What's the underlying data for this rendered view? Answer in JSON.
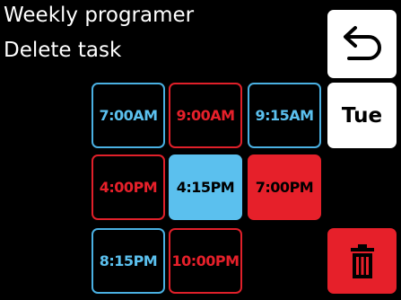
{
  "header": {
    "line1": "Weekly programer",
    "line2": "Delete task"
  },
  "side_buttons": {
    "back_icon": "back-arrow-icon",
    "day_label": "Tue",
    "delete_icon": "trash-icon"
  },
  "colors": {
    "background": "#000000",
    "blue": "#5bc0ee",
    "red": "#e6202a",
    "white": "#ffffff"
  },
  "time_slots": [
    {
      "time": "7:00AM",
      "state": "enabled"
    },
    {
      "time": "9:00AM",
      "state": "disabled"
    },
    {
      "time": "9:15AM",
      "state": "enabled"
    },
    {
      "time": "4:00PM",
      "state": "disabled"
    },
    {
      "time": "4:15PM",
      "state": "selected-blue"
    },
    {
      "time": "7:00PM",
      "state": "selected-red"
    },
    {
      "time": "8:15PM",
      "state": "enabled"
    },
    {
      "time": "10:00PM",
      "state": "disabled"
    }
  ]
}
